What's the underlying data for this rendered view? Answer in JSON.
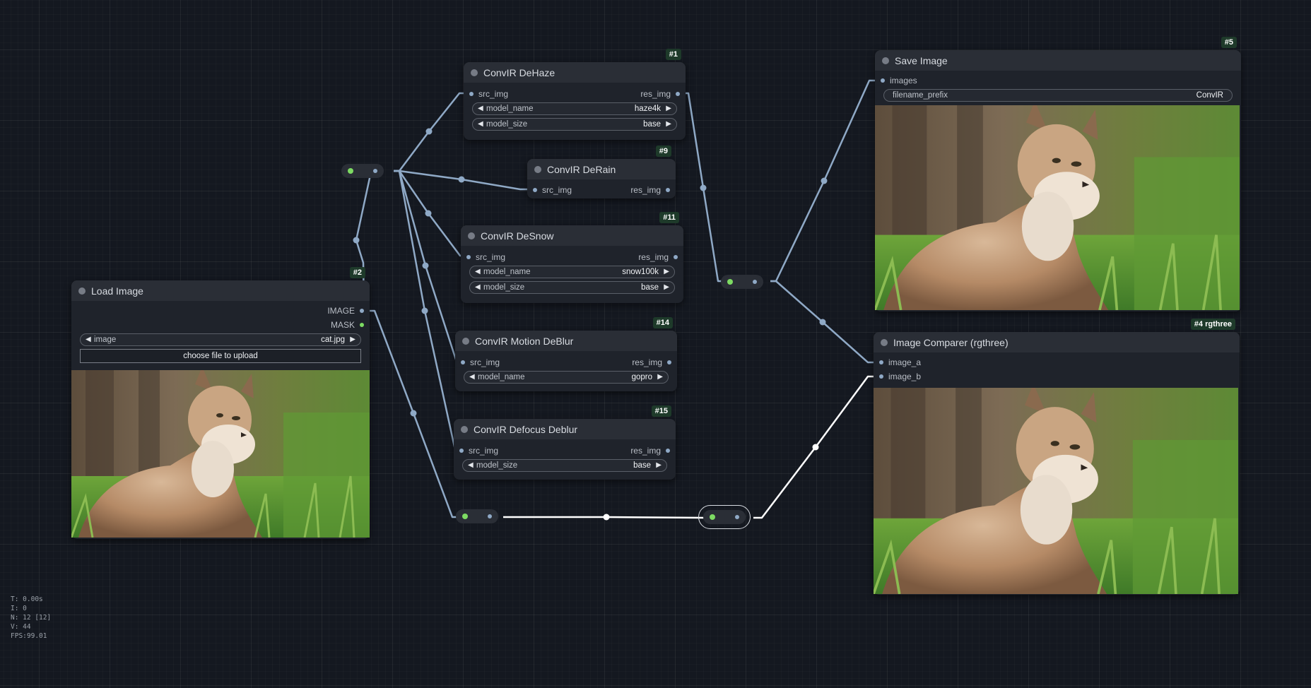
{
  "nodes": {
    "dehaze": {
      "badge": "#1",
      "title": "ConvIR DeHaze",
      "input": "src_img",
      "output": "res_img",
      "widgets": [
        {
          "label": "model_name",
          "value": "haze4k"
        },
        {
          "label": "model_size",
          "value": "base"
        }
      ]
    },
    "derain": {
      "badge": "#9",
      "title": "ConvIR DeRain",
      "input": "src_img",
      "output": "res_img"
    },
    "desnow": {
      "badge": "#11",
      "title": "ConvIR DeSnow",
      "input": "src_img",
      "output": "res_img",
      "widgets": [
        {
          "label": "model_name",
          "value": "snow100k"
        },
        {
          "label": "model_size",
          "value": "base"
        }
      ]
    },
    "motion_deblur": {
      "badge": "#14",
      "title": "ConvIR Motion DeBlur",
      "input": "src_img",
      "output": "res_img",
      "widgets": [
        {
          "label": "model_name",
          "value": "gopro"
        }
      ]
    },
    "defocus_deblur": {
      "badge": "#15",
      "title": "ConvIR Defocus Deblur",
      "input": "src_img",
      "output": "res_img",
      "widgets": [
        {
          "label": "model_size",
          "value": "base"
        }
      ]
    },
    "load_image": {
      "badge": "#2",
      "title": "Load Image",
      "outputs": [
        "IMAGE",
        "MASK"
      ],
      "widget": {
        "label": "image",
        "value": "cat.jpg"
      },
      "upload_label": "choose file to upload"
    },
    "save_image": {
      "badge": "#5",
      "title": "Save Image",
      "input": "images",
      "widget": {
        "label": "filename_prefix",
        "value": "ConvIR"
      }
    },
    "image_comparer": {
      "badge": "#4 rgthree",
      "title": "Image Comparer (rgthree)",
      "inputs": [
        "image_a",
        "image_b"
      ]
    }
  },
  "colors": {
    "canvas": "#141820",
    "node_body": "#1f232b",
    "node_title": "#2a2e36",
    "link": "#8fa9c6",
    "link_selected": "#ffffff",
    "reroute_input": "#7ddb63",
    "badge": "#1e3a2a"
  },
  "stats": {
    "t": "T: 0.00s",
    "i": "I: 0",
    "n": "N: 12 [12]",
    "v": "V: 44",
    "fps": "FPS:99.01"
  }
}
